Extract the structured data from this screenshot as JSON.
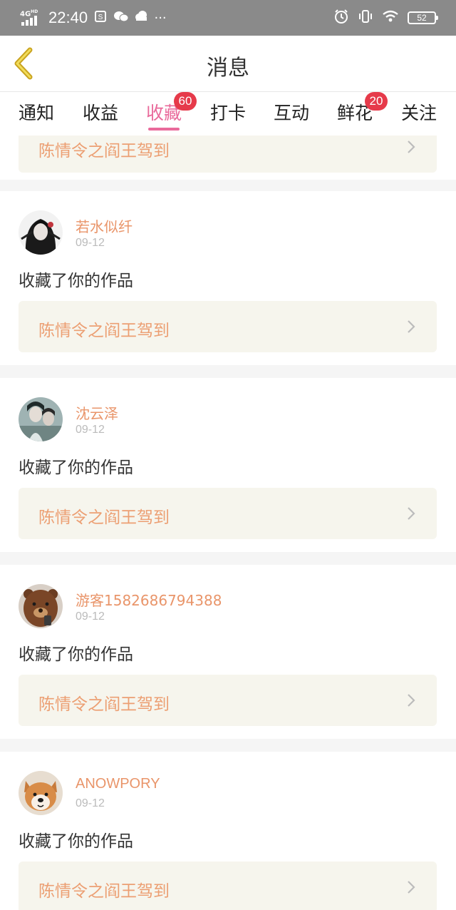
{
  "status_bar": {
    "network": "4G",
    "network_sup": "HD",
    "time": "22:40",
    "icons": [
      "sim-icon",
      "wechat-icon",
      "cloud-icon",
      "more-dots-icon"
    ],
    "more": "···",
    "right_icons": [
      "alarm-icon",
      "vibrate-icon",
      "wifi-icon"
    ],
    "battery": "52"
  },
  "header": {
    "title": "消息",
    "back_icon": "chevron-left-icon"
  },
  "tabs": [
    {
      "label": "通知"
    },
    {
      "label": "收益"
    },
    {
      "label": "收藏",
      "badge": "60",
      "active": true
    },
    {
      "label": "打卡"
    },
    {
      "label": "互动"
    },
    {
      "label": "鲜花",
      "badge": "20"
    },
    {
      "label": "关注"
    }
  ],
  "partial_item": {
    "work_title": "陈情令之阎王驾到"
  },
  "items": [
    {
      "user": "若水似纤",
      "date": "09-12",
      "action": "收藏了你的作品",
      "work_title": "陈情令之阎王驾到",
      "avatar": "anime-girl-avatar"
    },
    {
      "user": "沈云泽",
      "date": "09-12",
      "action": "收藏了你的作品",
      "work_title": "陈情令之阎王驾到",
      "avatar": "anime-boy-avatar"
    },
    {
      "user": "游客1582686794388",
      "date": "09-12",
      "action": "收藏了你的作品",
      "work_title": "陈情令之阎王驾到",
      "avatar": "bear-avatar"
    },
    {
      "user": "ANOWPORY",
      "date": "09-12",
      "action": "收藏了你的作品",
      "work_title": "陈情令之阎王驾到",
      "avatar": "shiba-dog-avatar"
    }
  ],
  "colors": {
    "accent_pink": "#e96a9b",
    "badge_red": "#e63a4a",
    "name_orange": "#e9956a",
    "card_bg": "#f6f5ed"
  }
}
